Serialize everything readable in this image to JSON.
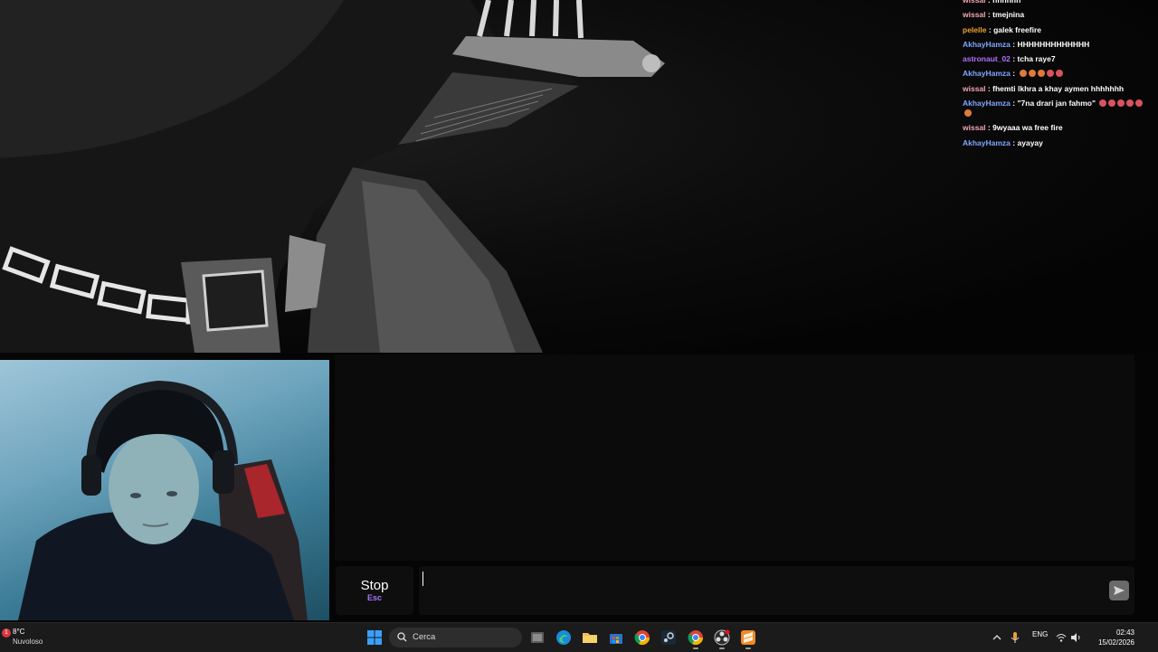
{
  "chat": {
    "messages": [
      {
        "user": "wissal",
        "color": "#f4a4b4",
        "text": "hhhhhh"
      },
      {
        "user": "wissal",
        "color": "#f4a4b4",
        "text": "tmejnina"
      },
      {
        "user": "pelelle",
        "color": "#f0a030",
        "text": "galek freefire"
      },
      {
        "user": "AkhayHamza",
        "color": "#7fa6ff",
        "text": "HHHHHHHHHHHHH"
      },
      {
        "user": "astronaut_02",
        "color": "#b070ff",
        "text": "tcha raye7"
      },
      {
        "user": "AkhayHamza",
        "color": "#7fa6ff",
        "text": "",
        "emotes": 5
      },
      {
        "user": "wissal",
        "color": "#f4a4b4",
        "text": "fhemti lkhra a khay aymen hhhhhhh"
      },
      {
        "user": "AkhayHamza",
        "color": "#7fa6ff",
        "text": "\"7na drari jan fahmo\"",
        "emotes": 6
      },
      {
        "user": "wissal",
        "color": "#f4a4b4",
        "text": "9wyaaa wa free fire"
      },
      {
        "user": "AkhayHamza",
        "color": "#7fa6ff",
        "text": "ayayay"
      }
    ],
    "separator": ":"
  },
  "controls": {
    "stop_label": "Stop",
    "stop_key": "Esc",
    "input_value": "",
    "input_placeholder": ""
  },
  "taskbar": {
    "weather_badge": "1",
    "weather_temp": "8°C",
    "weather_condition": "Nuvoloso",
    "search_placeholder": "Cerca",
    "language": "ENG",
    "time": "02:43",
    "date": "15/02/2026"
  },
  "colors": {
    "accent_esc": "#a574ff",
    "taskbar_bg": "#1b1b1b",
    "panel_bg": "#0b0b0b"
  }
}
